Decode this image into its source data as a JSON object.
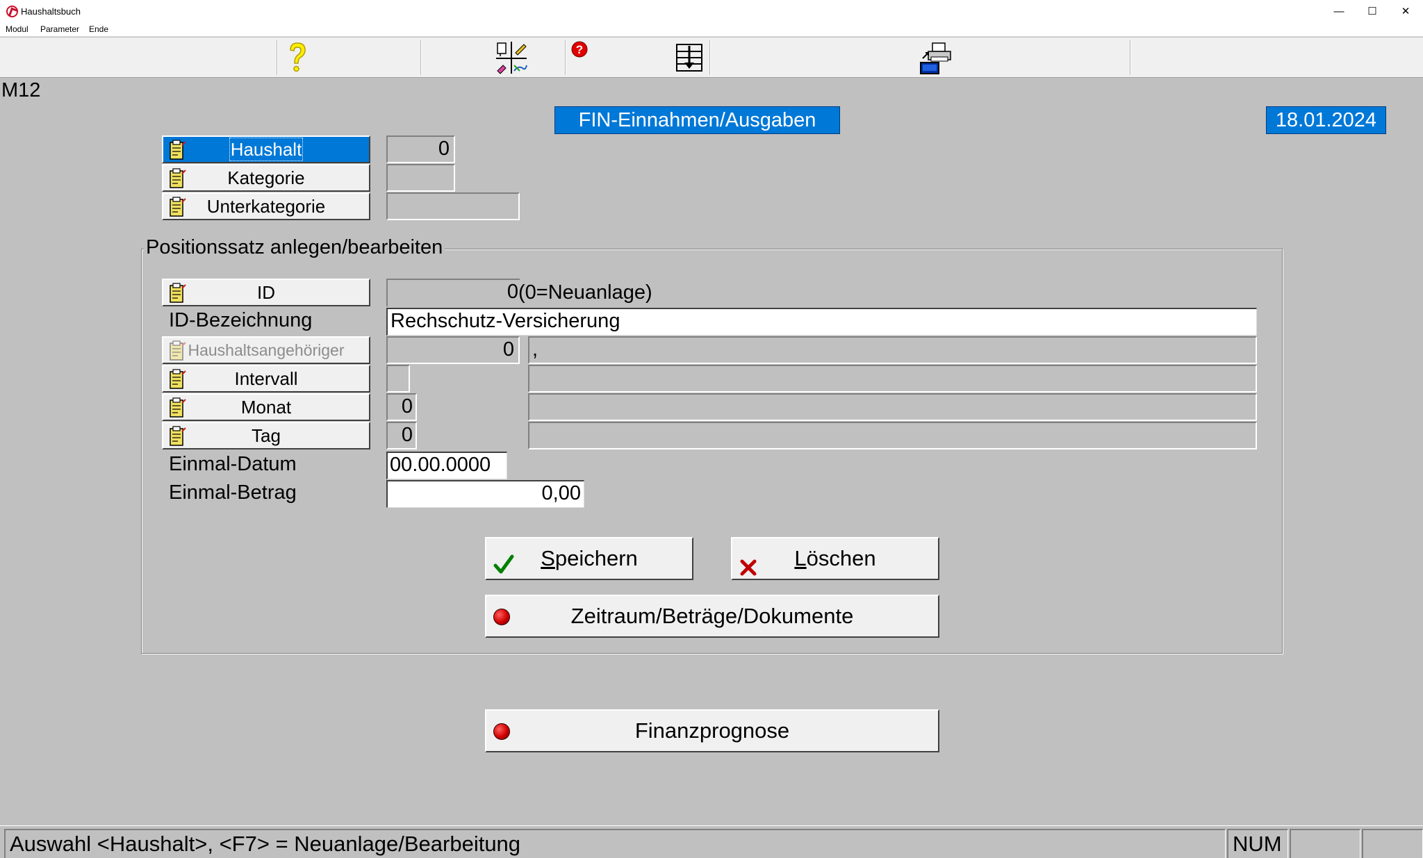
{
  "window": {
    "title": "Haushaltsbuch",
    "minimize_glyph": "—",
    "maximize_glyph": "☐",
    "close_glyph": "✕"
  },
  "menu": [
    {
      "label": "Modul"
    },
    {
      "label": "Parameter"
    },
    {
      "label": "Ende"
    }
  ],
  "toolbar": {
    "icons": [
      "help-icon",
      "edit-list-icon",
      "info-icon",
      "download-list-icon",
      "print-icon"
    ]
  },
  "header": {
    "module_code": "M12",
    "title": "FIN-Einnahmen/Ausgaben",
    "date": "18.01.2024"
  },
  "selectors": {
    "haushalt_label": "Haushalt",
    "haushalt_value": "0",
    "kategorie_label": "Kategorie",
    "kategorie_value": "",
    "unterkategorie_label": "Unterkategorie",
    "unterkategorie_value": ""
  },
  "group": {
    "title": "Positionssatz anlegen/bearbeiten",
    "id_label": "ID",
    "id_value": "0",
    "id_hint": "(0=Neuanlage)",
    "bezeichnung_label": "ID-Bezeichnung",
    "bezeichnung_value": "Rechschutz-Versicherung",
    "angehoeriger_label": "Haushaltsangehöriger",
    "angehoeriger_value": "0",
    "angehoeriger_name": ",",
    "intervall_label": "Intervall",
    "intervall_value": "",
    "intervall_text": "",
    "monat_label": "Monat",
    "monat_value": "0",
    "monat_text": "",
    "tag_label": "Tag",
    "tag_value": "0",
    "tag_text": "",
    "einmal_datum_label": "Einmal-Datum",
    "einmal_datum_value": "00.00.0000",
    "einmal_betrag_label": "Einmal-Betrag",
    "einmal_betrag_value": "0,00"
  },
  "buttons": {
    "save_pre": "",
    "save_ul": "S",
    "save_rest": "peichern",
    "delete_ul": "L",
    "delete_rest": "öschen",
    "zeitraum": "Zeitraum/Beträge/Dokumente",
    "finanzprognose": "Finanzprognose"
  },
  "status": {
    "message": "Auswahl <Haushalt>, <F7> = Neuanlage/Bearbeitung",
    "num": "NUM",
    "pane3": "",
    "pane4": ""
  }
}
